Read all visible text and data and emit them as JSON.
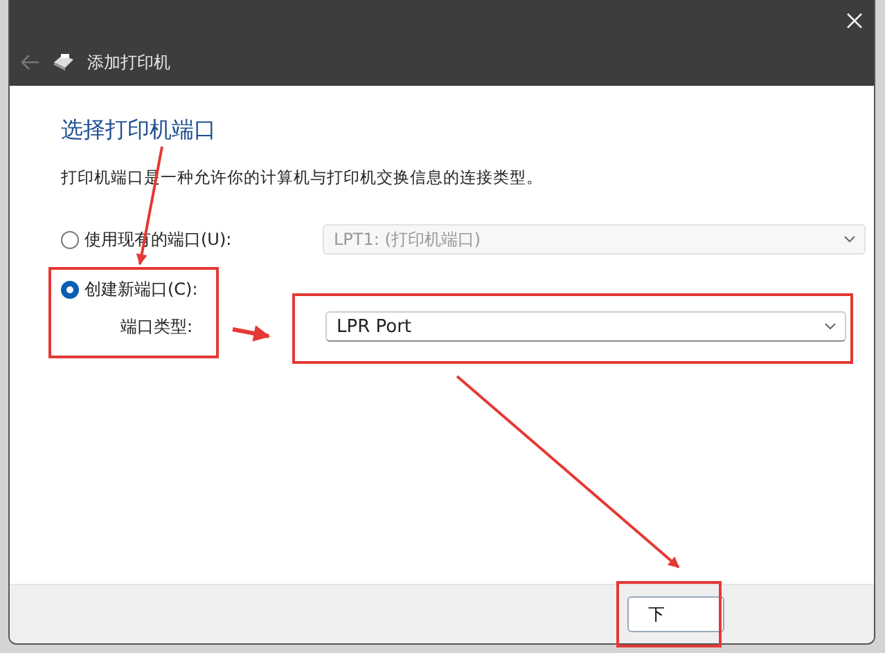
{
  "window": {
    "title": "添加打印机"
  },
  "heading": "选择打印机端口",
  "description": "打印机端口是一种允许你的计算机与打印机交换信息的连接类型。",
  "options": [
    {
      "label": "使用现有的端口(U):",
      "selected": false,
      "dropdown": {
        "value": "LPT1: (打印机端口)",
        "disabled": true
      }
    },
    {
      "label": "创建新端口(C):",
      "selected": true
    }
  ],
  "port_type": {
    "label": "端口类型:",
    "value": "LPR Port",
    "disabled": false
  },
  "buttons": [
    {
      "label": "下"
    }
  ]
}
